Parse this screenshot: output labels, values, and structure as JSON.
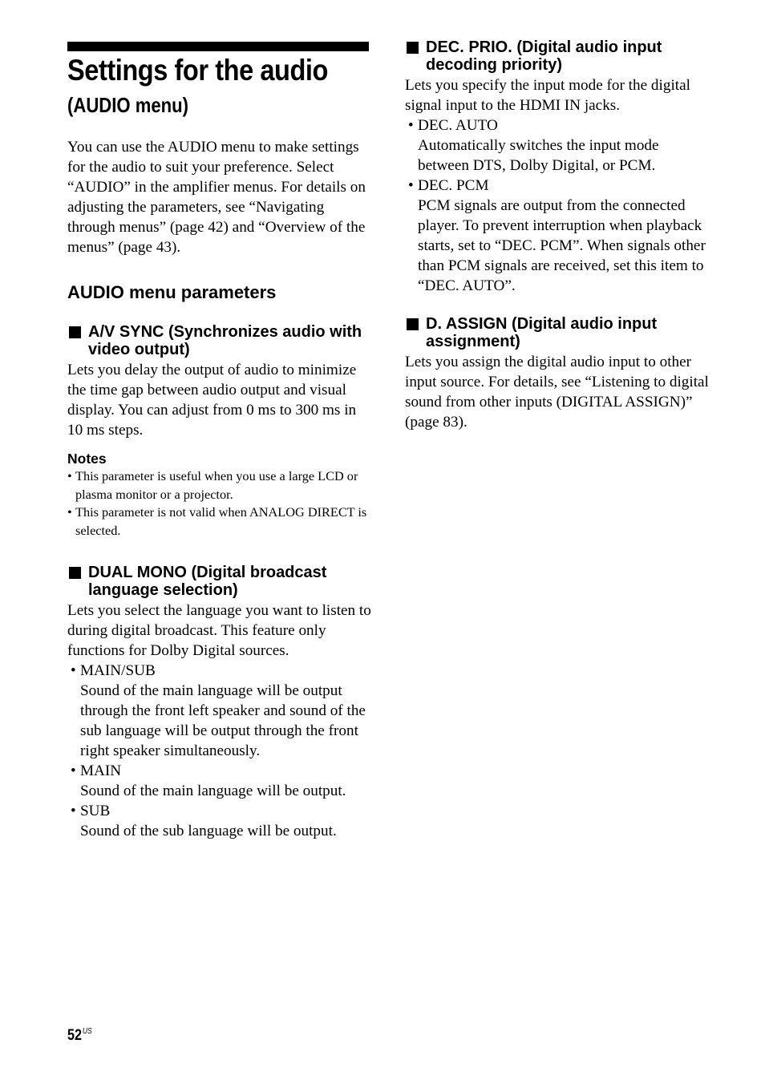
{
  "page": {
    "title": "Settings for the audio",
    "subtitle": "(AUDIO menu)",
    "intro": "You can use the AUDIO menu to make settings for the audio to suit your preference. Select “AUDIO” in the amplifier menus. For details on adjusting the parameters, see “Navigating through menus” (page 42) and “Overview of the menus” (page 43).",
    "parameters_heading": "AUDIO menu parameters",
    "page_number": "52",
    "page_region": "US"
  },
  "sections": {
    "av_sync": {
      "heading": "A/V SYNC (Synchronizes audio with video output)",
      "body": "Lets you delay the output of audio to minimize the time gap between audio output and visual display. You can adjust from 0 ms to 300 ms in 10 ms steps.",
      "notes_heading": "Notes",
      "notes": [
        "This parameter is useful when you use a large LCD or plasma monitor or a projector.",
        "This parameter is not valid when ANALOG DIRECT is selected."
      ]
    },
    "dual_mono": {
      "heading": "DUAL MONO (Digital broadcast language selection)",
      "body": "Lets you select the language you want to listen to during digital broadcast. This feature only functions for Dolby Digital sources.",
      "options": [
        {
          "name": "MAIN/SUB",
          "desc": "Sound of the main language will be output through the front left speaker and sound of the sub language will be output through the front right speaker simultaneously."
        },
        {
          "name": "MAIN",
          "desc": "Sound of the main language will be output."
        },
        {
          "name": "SUB",
          "desc": "Sound of the sub language will be output."
        }
      ]
    },
    "dec_prio": {
      "heading": "DEC. PRIO. (Digital audio input decoding priority)",
      "body": "Lets you specify the input mode for the digital signal input to the HDMI IN jacks.",
      "options": [
        {
          "name": "DEC. AUTO",
          "desc": "Automatically switches the input mode between DTS, Dolby Digital, or PCM."
        },
        {
          "name": "DEC. PCM",
          "desc": "PCM signals are output from the connected player. To prevent interruption when playback starts, set to “DEC. PCM”. When signals other than PCM signals are received, set this item to “DEC. AUTO”."
        }
      ]
    },
    "d_assign": {
      "heading": "D. ASSIGN (Digital audio input assignment)",
      "body": "Lets you assign the digital audio input to other input source. For details, see “Listening to digital sound from other inputs (DIGITAL ASSIGN)” (page 83)."
    }
  },
  "symbols": {
    "section_marker": "black-square",
    "bullet": "•"
  }
}
